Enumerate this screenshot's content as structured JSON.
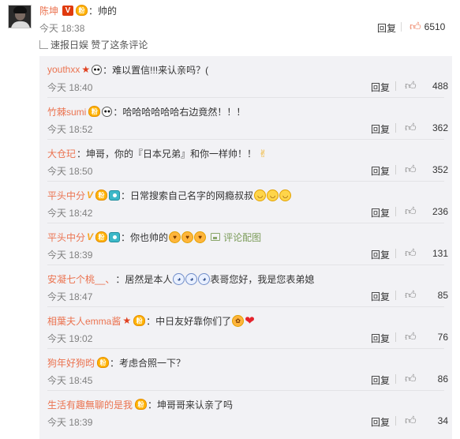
{
  "main_comment": {
    "username": "陈坤",
    "badge_v": "V",
    "medal": "粉",
    "colon": "：",
    "text": "帅的",
    "time": "今天 18:38",
    "reply_label": "回复",
    "likes": "6510",
    "forward_text": "速报日娱 赞了这条评论"
  },
  "replies": [
    {
      "username": "youthxx",
      "colon": "：",
      "text": "难以置信!!!来认亲吗？(",
      "time": "今天 18:40",
      "reply_label": "回复",
      "likes": "488"
    },
    {
      "username": "竹棘sumi",
      "colon": "：",
      "text": "哈哈哈哈哈哈右边竟然！！！",
      "time": "今天 18:52",
      "reply_label": "回复",
      "likes": "362"
    },
    {
      "username": "大仓玘",
      "colon": "：",
      "text": "坤哥，你的『日本兄弟』和你一样帅！！",
      "time": "今天 18:50",
      "reply_label": "回复",
      "likes": "352"
    },
    {
      "username": "平头中分",
      "colon": "：",
      "text": "日常搜索自己名字的网瘾叔叔",
      "time": "今天 18:42",
      "reply_label": "回复",
      "likes": "236"
    },
    {
      "username": "平头中分",
      "colon": "：",
      "text": "你也帅的",
      "pic_label": "评论配图",
      "time": "今天 18:39",
      "reply_label": "回复",
      "likes": "131"
    },
    {
      "username": "安凝七个桃__、",
      "colon": "：",
      "text": "居然是本人",
      "text2": "表哥您好，我是您表弟媳",
      "time": "今天 18:47",
      "reply_label": "回复",
      "likes": "85"
    },
    {
      "username": "相葉夫人emma酱",
      "colon": "：",
      "text": "中日友好靠你们了",
      "time": "今天 19:02",
      "reply_label": "回复",
      "likes": "76"
    },
    {
      "username": "狗年好狗昀",
      "colon": "：",
      "text": "考虑合照一下？",
      "time": "今天 18:45",
      "reply_label": "回复",
      "likes": "86"
    },
    {
      "username": "生活有趣無聊的是我",
      "colon": "：",
      "text": "坤哥哥来认亲了吗",
      "time": "今天 18:39",
      "reply_label": "回复",
      "likes": "34"
    }
  ],
  "icons": {
    "like": "thumbs-up-icon",
    "forward": "forward-corner-icon",
    "vip": "vip-v-badge-icon",
    "fan_medal": "fan-medal-icon",
    "star": "star-badge-icon",
    "panda": "panda-badge-icon",
    "camera": "camera-badge-icon",
    "picture": "picture-icon"
  },
  "colors": {
    "username": "#eb7350",
    "liked_thumb": "#eb7350",
    "list_bg": "#f2f2f5",
    "time": "#808080",
    "pic_link": "#7c9c5a"
  }
}
